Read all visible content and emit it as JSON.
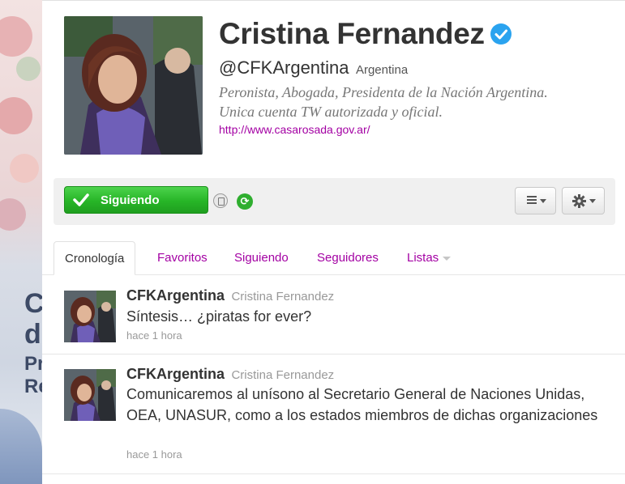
{
  "profile": {
    "name": "Cristina Fernandez",
    "handle": "@CFKArgentina",
    "location": "Argentina",
    "bio_line1": "Peronista, Abogada, Presidenta de la Nación Argentina.",
    "bio_line2": "Unica cuenta TW autorizada y oficial.",
    "url": "http://www.casarosada.gov.ar/",
    "verified": true
  },
  "actions": {
    "follow_label": "Siguiendo",
    "list_icon": "list-icon",
    "gear_icon": "gear-icon"
  },
  "tabs": [
    {
      "label": "Cronología",
      "active": true
    },
    {
      "label": "Favoritos"
    },
    {
      "label": "Siguiendo"
    },
    {
      "label": "Seguidores"
    },
    {
      "label": "Listas"
    }
  ],
  "tweets": [
    {
      "screen_name": "CFKArgentina",
      "full_name": "Cristina Fernandez",
      "text": "Síntesis… ¿piratas for ever?",
      "time": "hace 1 hora"
    },
    {
      "screen_name": "CFKArgentina",
      "full_name": "Cristina Fernandez",
      "text": "Comunicaremos al unísono al Secretario General de Naciones Unidas, OEA, UNASUR, como a los estados miembros de dichas organizaciones",
      "time": "hace 1 hora"
    }
  ],
  "background": {
    "letters": [
      "C",
      "d",
      "Pr",
      "Re"
    ]
  },
  "colors": {
    "link": "#a300a3",
    "follow_green": "#27b527",
    "verified_blue": "#2aa3ef"
  }
}
